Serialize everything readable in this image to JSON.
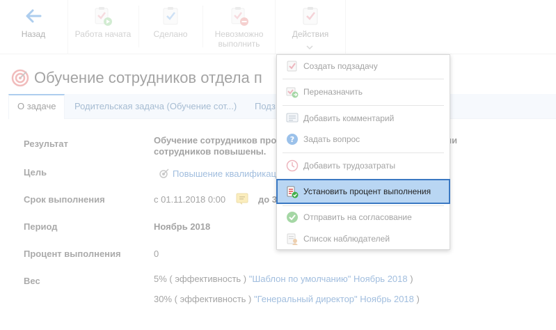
{
  "toolbar": {
    "back_label": "Назад",
    "started_label": "Работа начата",
    "done_label": "Сделано",
    "impossible_label_line1": "Невозможно",
    "impossible_label_line2": "выполнить",
    "actions_label": "Действия"
  },
  "task": {
    "title": "Обучение сотрудников отдела п"
  },
  "tabs": [
    {
      "label": "О задаче"
    },
    {
      "label": "Родительская задача (Обучение сот...)"
    },
    {
      "label": "Подз"
    }
  ],
  "fields": {
    "result_label": "Результат",
    "result_value_part1": "Обучение сотрудников про",
    "result_value_part2": "ификации",
    "result_value_line2": "сотрудников повышены.",
    "goal_label": "Цель",
    "goal_value": "Повышение квалификац",
    "deadline_label": "Срок выполнения",
    "deadline_from": "с 01.11.2018 0:00",
    "deadline_to": "до 3",
    "period_label": "Период",
    "period_value": "Ноябрь 2018",
    "percent_label": "Процент выполнения",
    "percent_value": "0",
    "weight_label": "Вес",
    "weight_rows": [
      {
        "pct": "5% ( эффективность )",
        "template": "\"Шаблон по умолчанию\" Ноябрь 2018",
        "close": ")"
      },
      {
        "pct": "30% ( эффективность )",
        "template": "\"Генеральный директор\" Ноябрь 2018",
        "close": ")"
      }
    ]
  },
  "menu": {
    "items": [
      {
        "label": "Создать подзадачу",
        "icon": "create-subtask-icon"
      },
      {
        "label": "Переназначить",
        "icon": "reassign-icon"
      },
      {
        "label": "Добавить комментарий",
        "icon": "comment-icon"
      },
      {
        "label": "Задать вопрос",
        "icon": "question-icon"
      },
      {
        "label": "Добавить трудозатраты",
        "icon": "clock-icon"
      },
      {
        "label": "Установить процент выполнения",
        "icon": "percent-icon"
      },
      {
        "label": "Отправить на согласование",
        "icon": "approval-icon"
      },
      {
        "label": "Список наблюдателей",
        "icon": "observers-icon"
      }
    ]
  },
  "colors": {
    "accent": "#3a78c2",
    "highlight": "#b9d6f3",
    "link": "#2d6db5",
    "tab_bg": "#eaf2fb"
  }
}
